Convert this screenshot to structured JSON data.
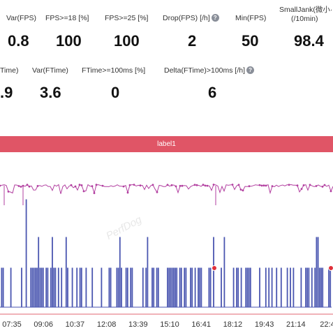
{
  "stats_row1": [
    {
      "label": "Var(FPS)",
      "value": "0.8",
      "help": false
    },
    {
      "label": "FPS>=18 [%]",
      "value": "100",
      "help": false
    },
    {
      "label": "FPS>=25 [%]",
      "value": "100",
      "help": false
    },
    {
      "label": "Drop(FPS) [/h]",
      "value": "2",
      "help": true
    },
    {
      "label": "Min(FPS)",
      "value": "50",
      "help": false
    },
    {
      "label": "SmallJank(微小·",
      "label2": "(/10min)",
      "value": "98.4",
      "help": false
    }
  ],
  "stats_row2": [
    {
      "label": "Time)",
      "value": ".9",
      "help": false
    },
    {
      "label": "Var(FTime)",
      "value": "3.6",
      "help": false
    },
    {
      "label": "FTime>=100ms [%]",
      "value": "0",
      "help": false
    },
    {
      "label": "Delta(FTime)>100ms [/h]",
      "value": "6",
      "help": true
    }
  ],
  "label_bar": "label1",
  "watermark": "PerfDog",
  "colors": {
    "fps_line": "#b23fa0",
    "ftime_line": "#4a56b0",
    "label_bar": "#e05566",
    "jank_marker": "#e0303a"
  },
  "chart_data": {
    "type": "line",
    "x_ticks": [
      "07:35",
      "09:06",
      "10:37",
      "12:08",
      "13:39",
      "15:10",
      "16:41",
      "18:12",
      "19:43",
      "21:14",
      "22:4"
    ],
    "series": [
      {
        "description": "FPS trace, steady near top with small dips",
        "level": 0.92
      },
      {
        "description": "Frame time trace, baseline with many spikes",
        "baseline": 0.05,
        "spike_mid": 0.33,
        "spike_high": 0.55,
        "spike_max": 0.82
      }
    ],
    "jank_markers_x_ticks": [
      "16:41",
      "22:4"
    ]
  }
}
